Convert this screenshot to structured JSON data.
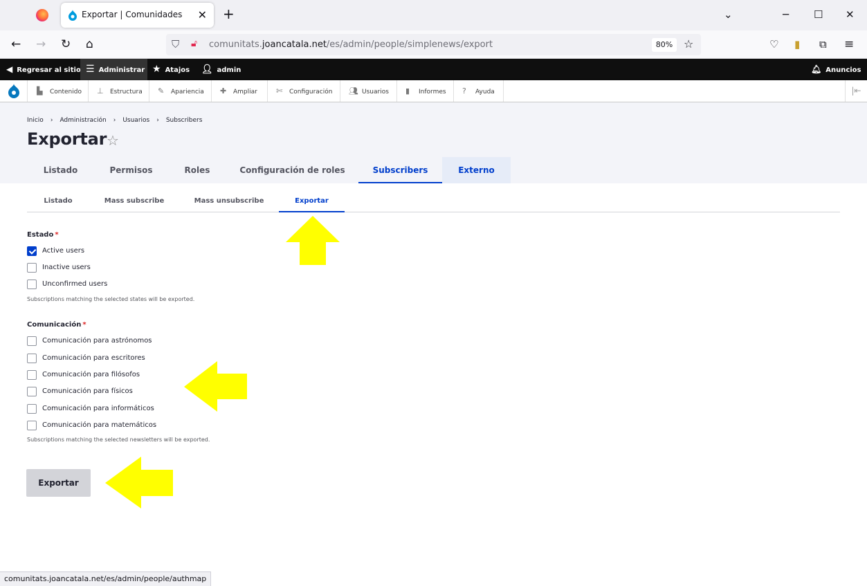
{
  "browser": {
    "tab_title": "Exportar | Comunidades",
    "url_prefix": "comunitats.",
    "url_domain": "joancatala.net",
    "url_path": "/es/admin/people/simplenews/export",
    "zoom": "80%",
    "status_url": "comunitats.joancatala.net/es/admin/people/authmap"
  },
  "toolbar": {
    "back_site": "Regresar al sitio",
    "manage": "Administrar",
    "shortcuts": "Atajos",
    "user": "admin",
    "announcements": "Anuncios"
  },
  "tray": {
    "items": [
      "Contenido",
      "Estructura",
      "Apariencia",
      "Ampliar",
      "Configuración",
      "Usuarios",
      "Informes",
      "Ayuda"
    ]
  },
  "breadcrumb": [
    "Inicio",
    "Administración",
    "Usuarios",
    "Subscribers"
  ],
  "page_title": "Exportar",
  "primary_tabs": [
    "Listado",
    "Permisos",
    "Roles",
    "Configuración de roles",
    "Subscribers",
    "Externo"
  ],
  "secondary_tabs": [
    "Listado",
    "Mass subscribe",
    "Mass unsubscribe",
    "Exportar"
  ],
  "estado": {
    "label": "Estado",
    "required": "*",
    "options": [
      {
        "label": "Active users",
        "checked": true
      },
      {
        "label": "Inactive users",
        "checked": false
      },
      {
        "label": "Unconfirmed users",
        "checked": false
      }
    ],
    "help": "Subscriptions matching the selected states will be exported."
  },
  "comunicacion": {
    "label": "Comunicación",
    "required": "*",
    "options": [
      {
        "label": "Comunicación para astrónomos",
        "checked": false
      },
      {
        "label": "Comunicación para escritores",
        "checked": false
      },
      {
        "label": "Comunicación para filósofos",
        "checked": false
      },
      {
        "label": "Comunicación para físicos",
        "checked": false
      },
      {
        "label": "Comunicación para informáticos",
        "checked": false
      },
      {
        "label": "Comunicación para matemáticos",
        "checked": false
      }
    ],
    "help": "Subscriptions matching the selected newsletters will be exported."
  },
  "submit_label": "Exportar",
  "colors": {
    "accent": "#003ecc",
    "toolbar_bg": "#0f0f0f",
    "header_bg": "#f3f4f9",
    "arrow": "#ffff00"
  }
}
